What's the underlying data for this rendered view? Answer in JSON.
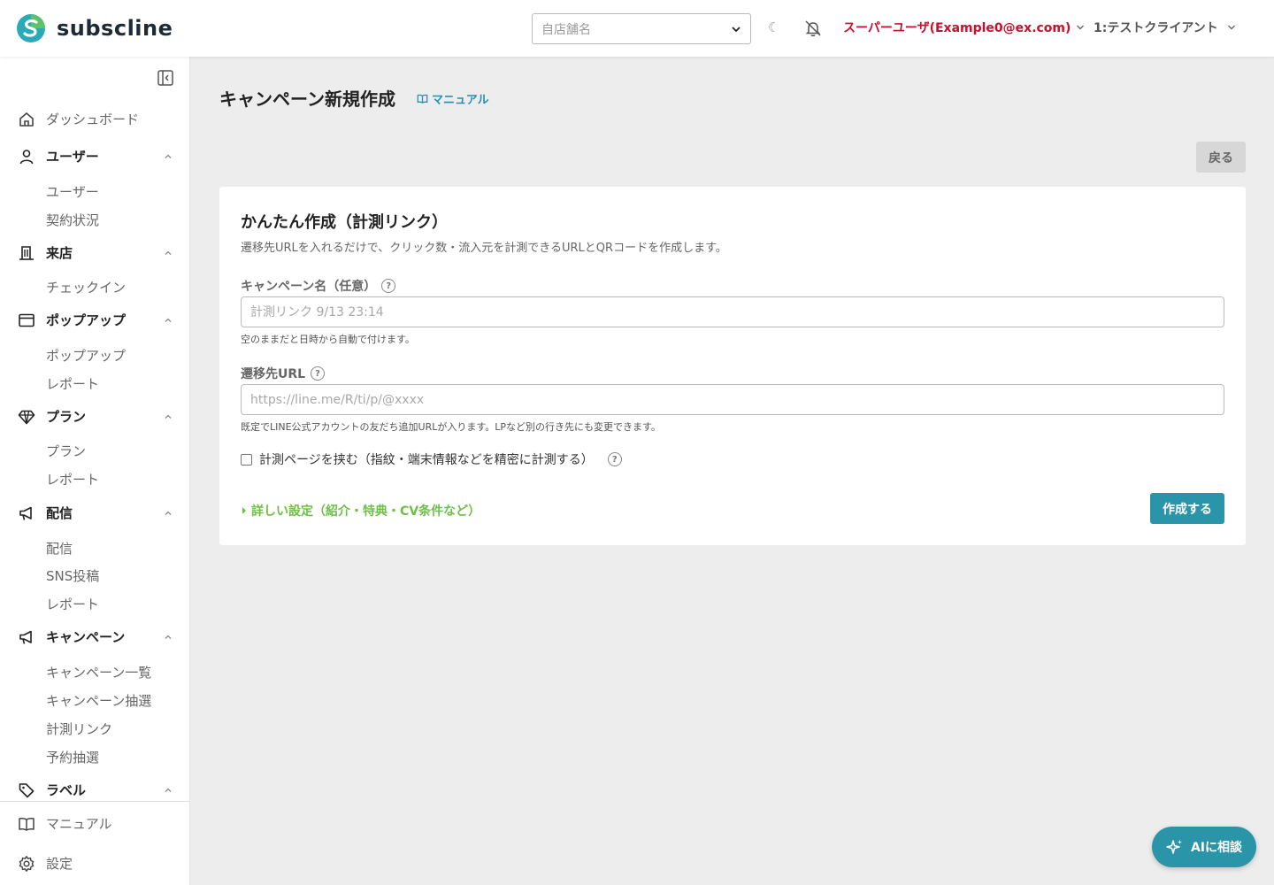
{
  "header": {
    "brand": "subscline",
    "store_select_placeholder": "自店舗名",
    "user_menu": "スーパーユーザ(Example0@ex.com)",
    "client_menu": "1:テストクライアント"
  },
  "sidebar": {
    "dashboard": "ダッシュボード",
    "sections": [
      {
        "label": "ユーザー",
        "items": [
          "ユーザー",
          "契約状況"
        ]
      },
      {
        "label": "来店",
        "items": [
          "チェックイン"
        ]
      },
      {
        "label": "ポップアップ",
        "items": [
          "ポップアップ",
          "レポート"
        ]
      },
      {
        "label": "プラン",
        "items": [
          "プラン",
          "レポート"
        ]
      },
      {
        "label": "配信",
        "items": [
          "配信",
          "SNS投稿",
          "レポート"
        ]
      },
      {
        "label": "キャンペーン",
        "items": [
          "キャンペーン一覧",
          "キャンペーン抽選",
          "計測リンク",
          "予約抽選"
        ]
      },
      {
        "label": "ラベル",
        "items": []
      }
    ],
    "bottom": {
      "manual": "マニュアル",
      "settings": "設定"
    }
  },
  "main": {
    "title": "キャンペーン新規作成",
    "manual_link": "マニュアル",
    "back_button": "戻る",
    "card": {
      "title": "かんたん作成（計測リンク）",
      "description": "遷移先URLを入れるだけで、クリック数・流入元を計測できるURLとQRコードを作成します。",
      "campaign_name_label": "キャンペーン名（任意）",
      "campaign_name_placeholder": "計測リンク 9/13 23:14",
      "campaign_name_hint": "空のままだと日時から自動で付けます。",
      "url_label": "遷移先URL",
      "url_placeholder": "https://line.me/R/ti/p/@xxxx",
      "url_hint": "既定でLINE公式アカウントの友だち追加URLが入ります。LPなど別の行き先にも変更できます。",
      "checkbox_label": "計測ページを挟む（指紋・端末情報などを精密に計測する）",
      "details_link": "詳しい設定（紹介・特典・CV条件など）",
      "create_button": "作成する"
    }
  },
  "ai_button": "AIに相談",
  "help_glyph": "?",
  "moon_glyph": "☾",
  "colors": {
    "accent": "#2a95a8",
    "user_menu": "#c8102e",
    "details_link": "#6cbf47"
  }
}
